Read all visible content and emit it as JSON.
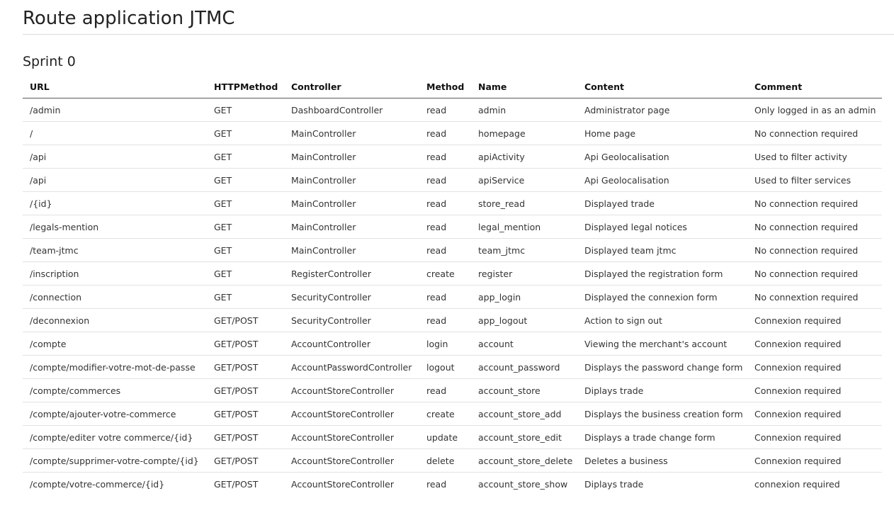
{
  "document": {
    "title": "Route application JTMC",
    "section_title": "Sprint 0"
  },
  "table": {
    "headers": [
      "URL",
      "HTTPMethod",
      "Controller",
      "Method",
      "Name",
      "Content",
      "Comment"
    ],
    "rows": [
      [
        "/admin",
        "GET",
        "DashboardController",
        "read",
        "admin",
        "Administrator page",
        "Only logged in as an admin"
      ],
      [
        "/",
        "GET",
        "MainController",
        "read",
        "homepage",
        "Home page",
        "No connection required"
      ],
      [
        "/api",
        "GET",
        "MainController",
        "read",
        "apiActivity",
        "Api Geolocalisation",
        "Used to filter activity"
      ],
      [
        "/api",
        "GET",
        "MainController",
        "read",
        "apiService",
        "Api Geolocalisation",
        "Used to filter services"
      ],
      [
        "/{id}",
        "GET",
        "MainController",
        "read",
        "store_read",
        "Displayed trade",
        "No connection required"
      ],
      [
        "/legals-mention",
        "GET",
        "MainController",
        "read",
        "legal_mention",
        "Displayed legal notices",
        "No connection required"
      ],
      [
        "/team-jtmc",
        "GET",
        "MainController",
        "read",
        "team_jtmc",
        "Displayed team jtmc",
        "No connection required"
      ],
      [
        "/inscription",
        "GET",
        "RegisterController",
        "create",
        "register",
        "Displayed the registration form",
        "No connection required"
      ],
      [
        "/connection",
        "GET",
        "SecurityController",
        "read",
        "app_login",
        "Displayed the connexion form",
        "No connextion required"
      ],
      [
        "/deconnexion",
        "GET/POST",
        "SecurityController",
        "read",
        "app_logout",
        "Action to sign out",
        "Connexion required"
      ],
      [
        "/compte",
        "GET/POST",
        "AccountController",
        "login",
        "account",
        "Viewing the merchant's account",
        "Connexion required"
      ],
      [
        "/compte/modifier-votre-mot-de-passe",
        "GET/POST",
        "AccountPasswordController",
        "logout",
        "account_password",
        "Displays the password change form",
        "Connexion required"
      ],
      [
        "/compte/commerces",
        "GET/POST",
        "AccountStoreController",
        "read",
        "account_store",
        "Diplays trade",
        "Connexion required"
      ],
      [
        "/compte/ajouter-votre-commerce",
        "GET/POST",
        "AccountStoreController",
        "create",
        "account_store_add",
        "Displays the business creation form",
        "Connexion required"
      ],
      [
        "/compte/editer votre commerce/{id}",
        "GET/POST",
        "AccountStoreController",
        "update",
        "account_store_edit",
        "Displays a trade change form",
        "Connexion required"
      ],
      [
        "/compte/supprimer-votre-compte/{id}",
        "GET/POST",
        "AccountStoreController",
        "delete",
        "account_store_delete",
        "Deletes a business",
        "Connexion required"
      ],
      [
        "/compte/votre-commerce/{id}",
        "GET/POST",
        "AccountStoreController",
        "read",
        "account_store_show",
        "Diplays trade",
        "connexion required"
      ]
    ]
  }
}
